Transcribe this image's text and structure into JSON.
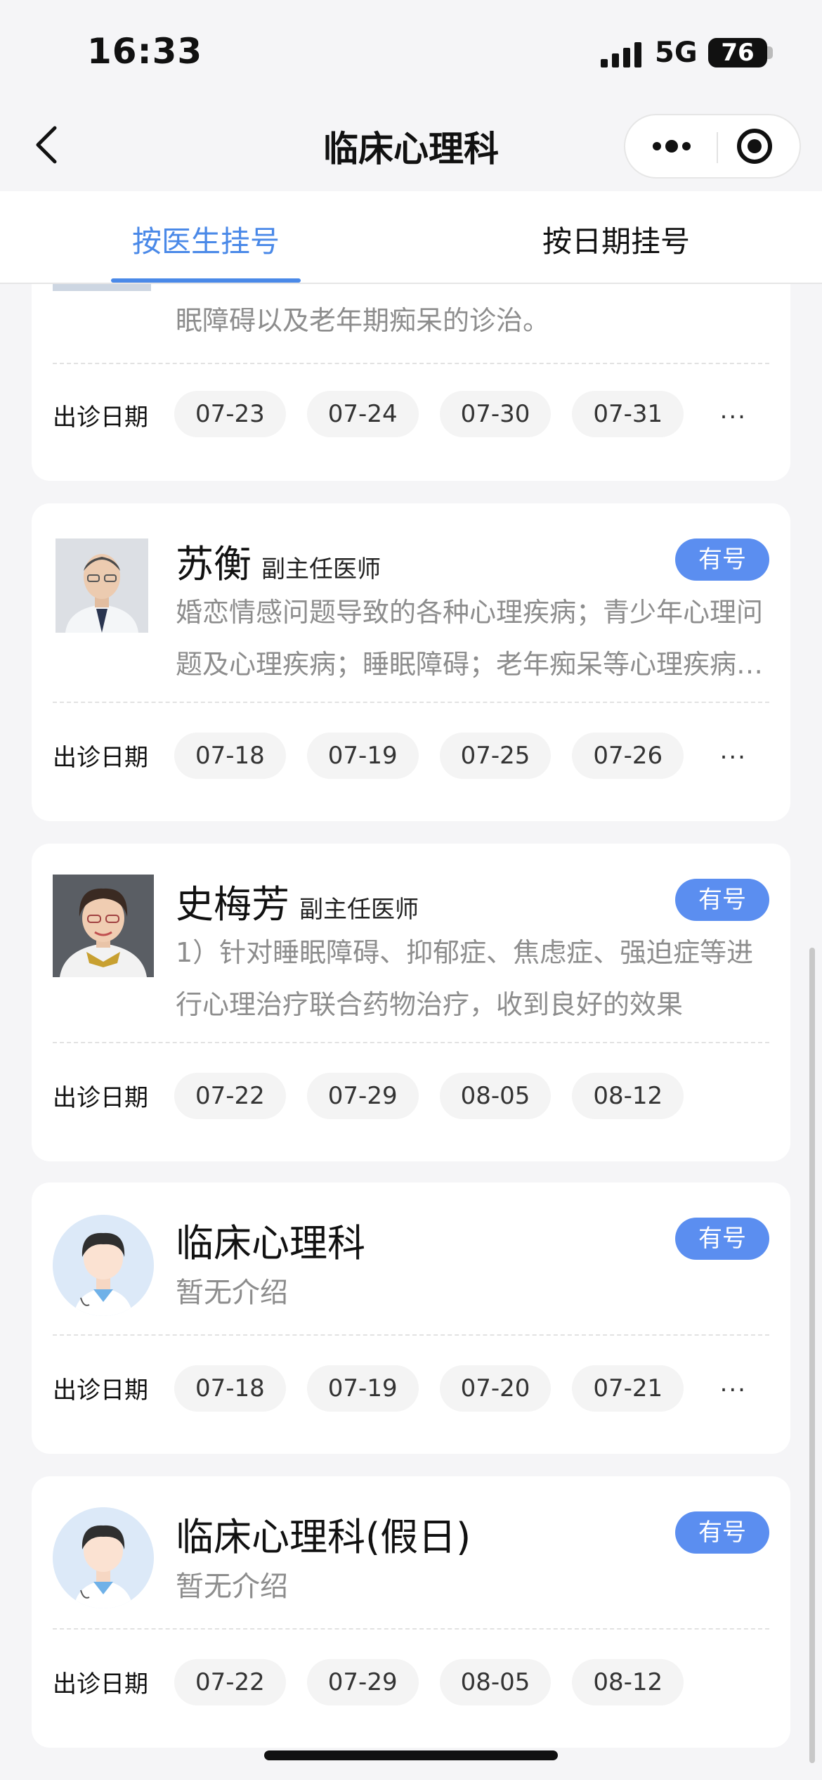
{
  "status_bar": {
    "time": "16:33",
    "network": "5G",
    "battery": "76"
  },
  "header": {
    "title": "临床心理科"
  },
  "tabs": [
    {
      "label": "按医生挂号",
      "active": true
    },
    {
      "label": "按日期挂号",
      "active": false
    }
  ],
  "accent_color": "#4a89e8",
  "badge_color": "#5b8ef0",
  "dates_label": "出诊日期",
  "partial_card": {
    "intro_tail": "眠障碍以及老年期痴呆的诊治。",
    "dates": [
      "07-23",
      "07-24",
      "07-30",
      "07-31"
    ],
    "more": "..."
  },
  "doctors": [
    {
      "name": "苏衡",
      "title": "副主任医师",
      "badge": "有号",
      "photo": "doctor-photo-male",
      "intro": "婚恋情感问题导致的各种心理疾病；青少年心理问题及心理疾病；睡眠障碍；老年痴呆等心理疾病的诊治",
      "dates": [
        "07-18",
        "07-19",
        "07-25",
        "07-26"
      ],
      "more": "..."
    },
    {
      "name": "史梅芳",
      "title": "副主任医师",
      "badge": "有号",
      "photo": "doctor-photo-female",
      "intro": "1）针对睡眠障碍、抑郁症、焦虑症、强迫症等进行心理治疗联合药物治疗，收到良好的效果",
      "dates": [
        "07-22",
        "07-29",
        "08-05",
        "08-12"
      ],
      "more": ""
    },
    {
      "name": "临床心理科",
      "title": "",
      "badge": "有号",
      "photo": "default-doctor-avatar",
      "intro": "暂无介绍",
      "dates": [
        "07-18",
        "07-19",
        "07-20",
        "07-21"
      ],
      "more": "..."
    },
    {
      "name": "临床心理科(假日)",
      "title": "",
      "badge": "有号",
      "photo": "default-doctor-avatar",
      "intro": "暂无介绍",
      "dates": [
        "07-22",
        "07-29",
        "08-05",
        "08-12"
      ],
      "more": ""
    }
  ]
}
